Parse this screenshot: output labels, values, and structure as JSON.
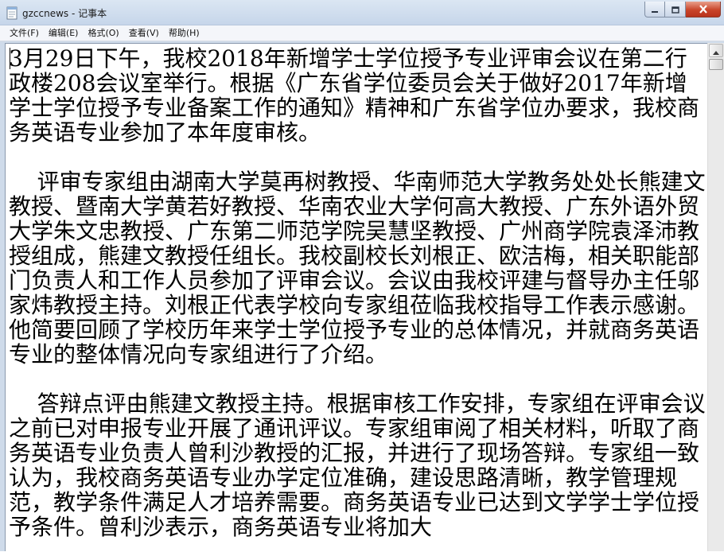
{
  "window": {
    "title": "gzccnews - 记事本"
  },
  "menu": {
    "items": [
      {
        "label": "文件(F)"
      },
      {
        "label": "编辑(E)"
      },
      {
        "label": "格式(O)"
      },
      {
        "label": "查看(V)"
      },
      {
        "label": "帮助(H)"
      }
    ]
  },
  "document": {
    "paragraphs": [
      "3月29日下午，我校2018年新增学士学位授予专业评审会议在第二行政楼208会议室举行。根据《广东省学位委员会关于做好2017年新增学士学位授予专业备案工作的通知》精神和广东省学位办要求，我校商务英语专业参加了本年度审核。",
      "    评审专家组由湖南大学莫再树教授、华南师范大学教务处处长熊建文教授、暨南大学黄若好教授、华南农业大学何高大教授、广东外语外贸大学朱文忠教授、广东第二师范学院吴慧坚教授、广州商学院袁泽沛教授组成，熊建文教授任组长。我校副校长刘根正、欧洁梅，相关职能部门负责人和工作人员参加了评审会议。会议由我校评建与督导办主任邬家炜教授主持。刘根正代表学校向专家组莅临我校指导工作表示感谢。他简要回顾了学校历年来学士学位授予专业的总体情况，并就商务英语专业的整体情况向专家组进行了介绍。",
      "    答辩点评由熊建文教授主持。根据审核工作安排，专家组在评审会议之前已对申报专业开展了通讯评议。专家组审阅了相关材料，听取了商务英语专业负责人曾利沙教授的汇报，并进行了现场答辩。专家组一致认为，我校商务英语专业办学定位准确，建设思路清晰，教学管理规范，教学条件满足人才培养需要。商务英语专业已达到文学学士学位授予条件。曾利沙表示，商务英语专业将加大"
    ]
  },
  "icons": {
    "app": "notepad-icon",
    "minimize": "minimize-icon",
    "maximize": "maximize-icon",
    "close": "close-icon",
    "scroll_up": "arrow-up-icon"
  }
}
